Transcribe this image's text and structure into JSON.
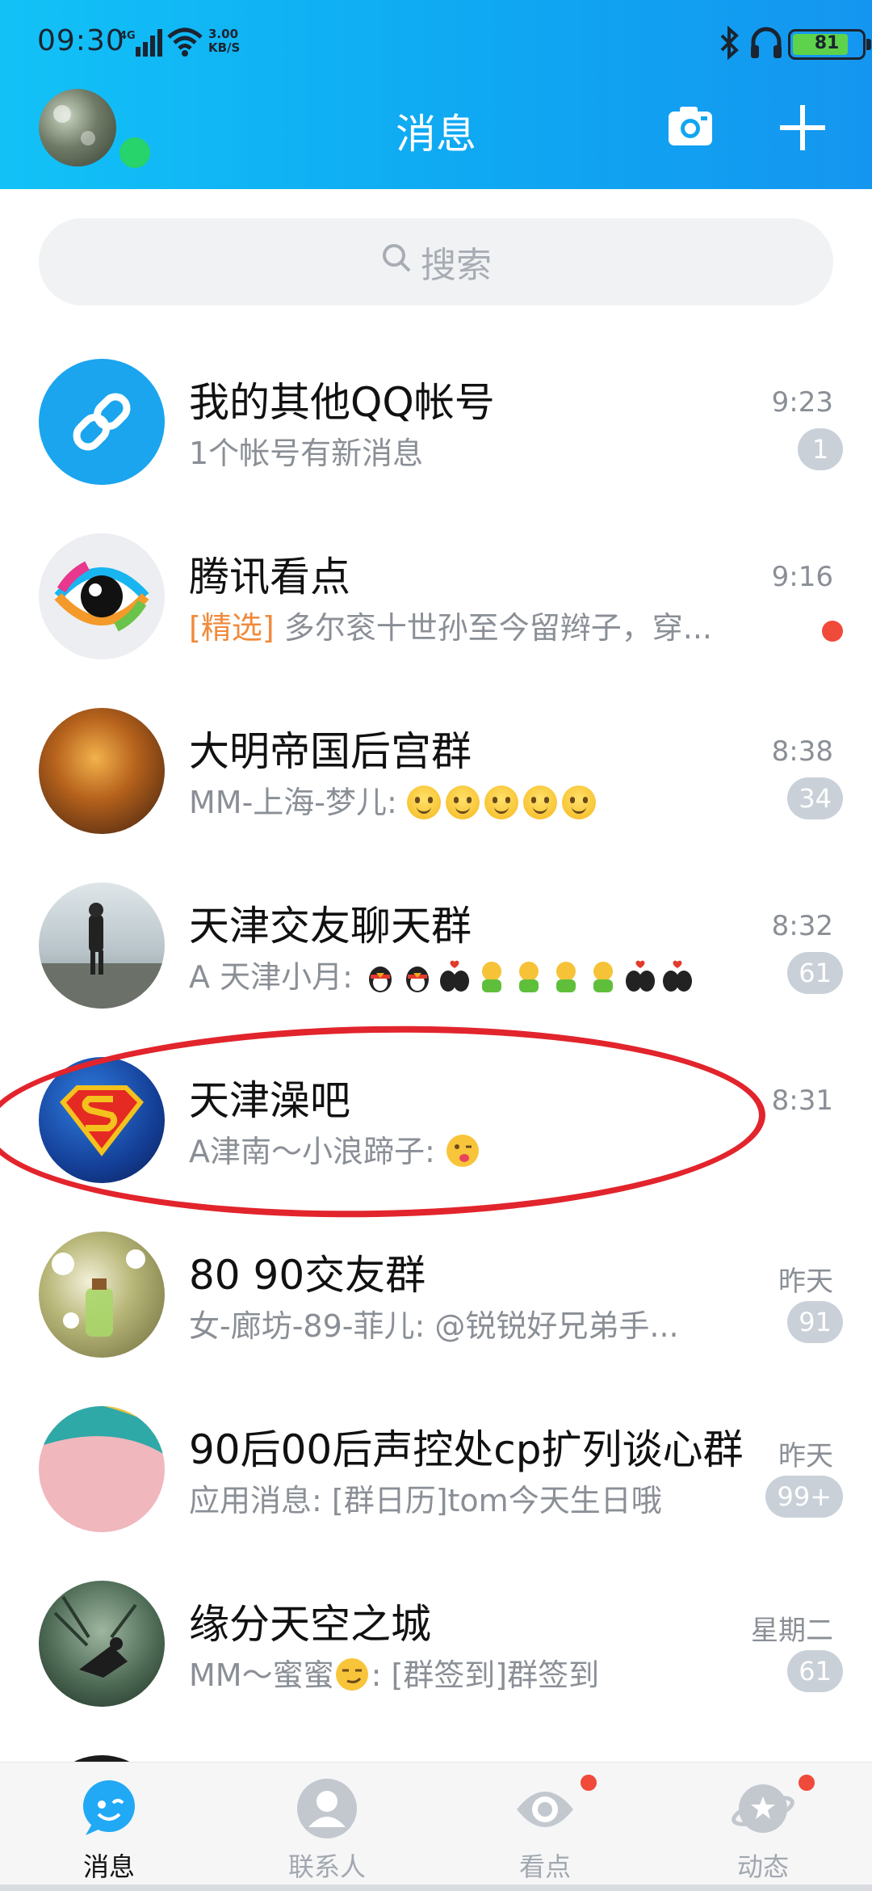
{
  "status_bar": {
    "time": "09:30",
    "network": "4G",
    "speed_value": "3.00",
    "speed_unit": "KB/S",
    "battery": "81"
  },
  "header": {
    "title": "消息",
    "camera_icon": "camera-icon",
    "plus_icon": "plus-icon"
  },
  "search": {
    "placeholder": "搜索"
  },
  "conversations": [
    {
      "name": "我的其他QQ帐号",
      "preview": "1个帐号有新消息",
      "time": "9:23",
      "badge": "1",
      "avatar": "link-icon"
    },
    {
      "name": "腾讯看点",
      "tag": "[精选]",
      "preview": "多尔衮十世孙至今留辫子，穿...",
      "time": "9:16",
      "badge": "",
      "avatar": "kandian-eye-icon"
    },
    {
      "name": "大明帝国后宫群",
      "preview": "MM-上海-梦儿: ",
      "time": "8:38",
      "badge": "34",
      "avatar": "group-avatar"
    },
    {
      "name": "天津交友聊天群",
      "preview": "A 天津小月: ",
      "time": "8:32",
      "badge": "61",
      "avatar": "group-avatar"
    },
    {
      "name": "天津澡吧",
      "preview": "A津南～小浪蹄子: ",
      "time": "8:31",
      "badge": "",
      "avatar": "superman-avatar"
    },
    {
      "name": "80 90交友群",
      "preview": "女-廊坊-89-菲儿: @锐锐好兄弟手...",
      "time": "昨天",
      "badge": "91",
      "avatar": "group-avatar"
    },
    {
      "name": "90后00后声控处cp扩列谈心群",
      "preview": "应用消息: [群日历]tom今天生日哦",
      "time": "昨天",
      "badge": "99+",
      "avatar": "group-avatar"
    },
    {
      "name": "缘分天空之城",
      "preview_a": "MM～蜜蜜",
      "preview_b": ": [群签到]群签到",
      "time": "星期二",
      "badge": "61",
      "avatar": "group-avatar"
    }
  ],
  "tabs": [
    {
      "label": "消息",
      "icon": "chat-bubble-icon"
    },
    {
      "label": "联系人",
      "icon": "contacts-icon"
    },
    {
      "label": "看点",
      "icon": "eye-icon"
    },
    {
      "label": "动态",
      "icon": "planet-icon"
    }
  ],
  "colors": {
    "header_start": "#12c2f7",
    "header_end": "#1496f0",
    "badge": "#c9d0d8",
    "red_dot": "#f04a3a",
    "annotation": "#e2242c"
  }
}
